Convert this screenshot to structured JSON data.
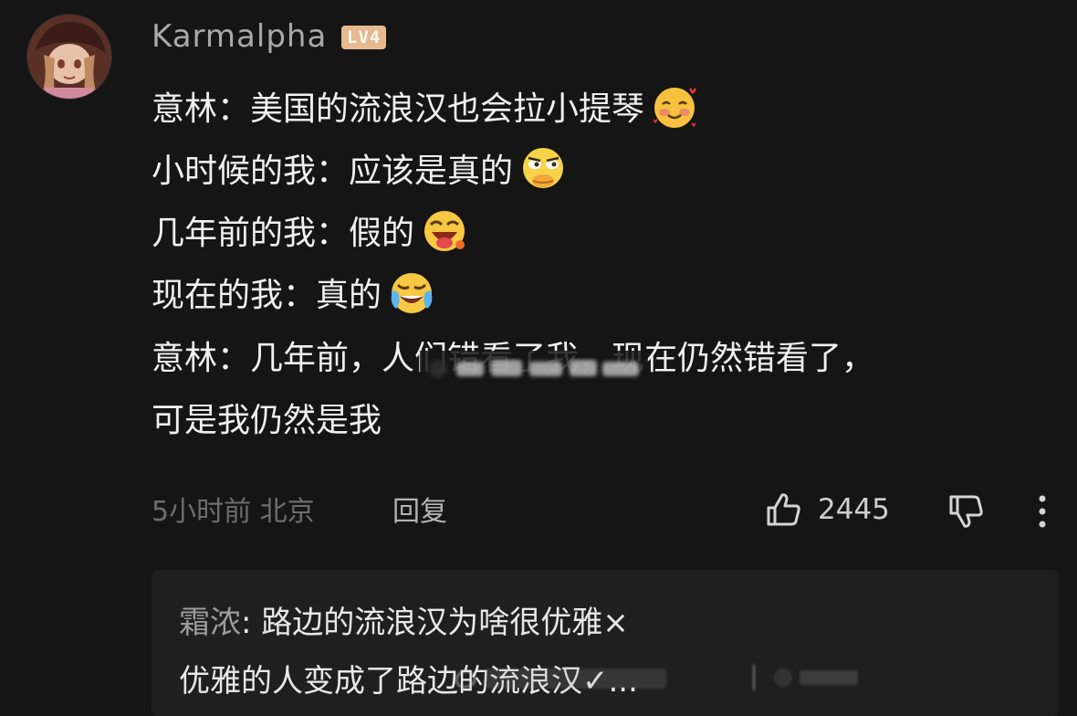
{
  "comment": {
    "username": "Karmalpha",
    "level": "LV4",
    "lines": [
      "意林：美国的流浪汉也会拉小提琴",
      "小时候的我：应该是真的",
      "几年前的我：假的",
      "现在的我：真的",
      "意林：几年前，人们错看了我，现在仍然错看了，",
      "可是我仍然是我"
    ],
    "emojis": [
      "blushing-hearts-emoji",
      "smug-duck-emoji",
      "tongue-out-emoji",
      "tears-of-joy-emoji"
    ],
    "time_location": "5小时前 北京",
    "reply_label": "回复",
    "like_count": "2445"
  },
  "reply": {
    "author": "霜浓",
    "line1_text": "路边的流浪汉为啥很优雅×",
    "line2_text": "优雅的人变成了路边的流浪汉✓..."
  },
  "colors": {
    "background": "#151515",
    "text": "#f0f0f0",
    "username": "#a9a9a9",
    "meta": "#6d6d6d",
    "level_badge": "#e7b98f",
    "reply_box": "#1f1f1f"
  }
}
